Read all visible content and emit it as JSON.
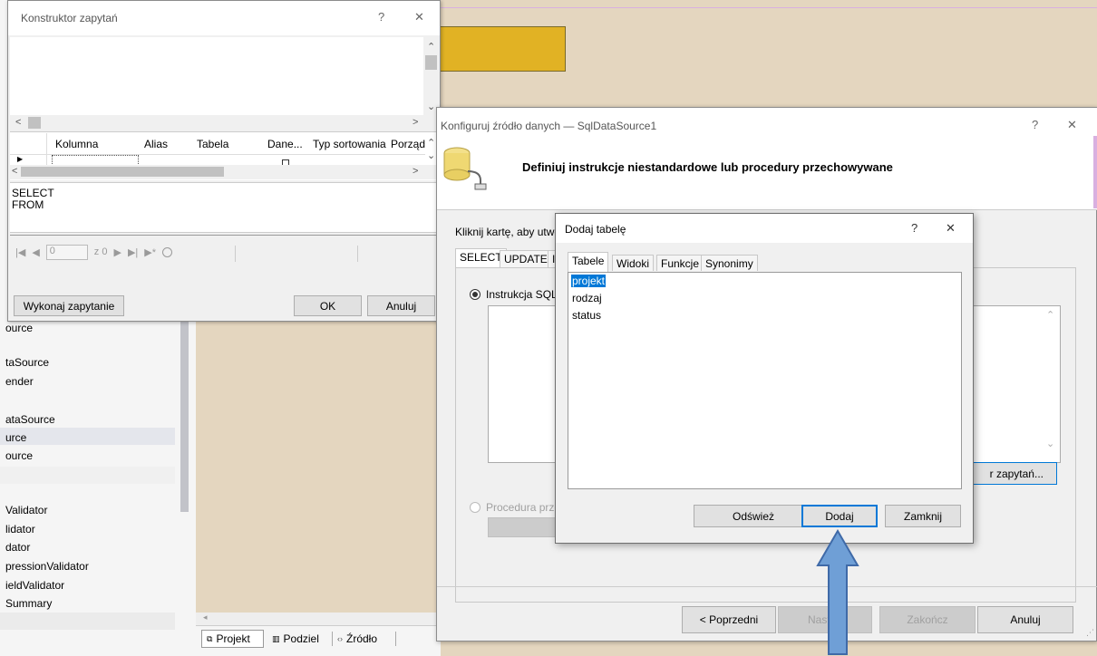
{
  "colors": {
    "designer_bg": "#e4d6bf",
    "yellow_box": "#e1b224",
    "dialog_bg": "#f0f0f0",
    "selection": "#0078d7",
    "arrow_fill": "#6f9fd6",
    "arrow_stroke": "#3f6aa8"
  },
  "toolbox": {
    "items": [
      "ource",
      "taSource",
      "ender",
      "ataSource",
      "urce",
      "ource",
      "Validator",
      "lidator",
      "dator",
      "pressionValidator",
      "ieldValidator",
      "Summary"
    ]
  },
  "design_bottom": {
    "tabs": [
      {
        "icon": "⧉",
        "label": "Projekt"
      },
      {
        "icon": "▥",
        "label": "Podziel"
      },
      {
        "icon": "‹›",
        "label": "Źródło"
      }
    ]
  },
  "query_builder": {
    "title": "Konstruktor zapytań",
    "help": "?",
    "close": "✕",
    "columns": [
      "Kolumna",
      "Alias",
      "Tabela",
      "Dane...",
      "Typ sortowania",
      "Porząd"
    ],
    "sql_lines": [
      "SELECT",
      "FROM"
    ],
    "nav": {
      "page_value": "0",
      "of_label": "z 0"
    },
    "execute_label": "Wykonaj zapytanie",
    "ok_label": "OK",
    "cancel_label": "Anuluj"
  },
  "configure": {
    "title": "Konfiguruj źródło danych — SqlDataSource1",
    "help": "?",
    "close": "✕",
    "heading": "Definiuj instrukcje niestandardowe lub procedury przechowywane",
    "instruction": "Kliknij kartę, aby utwo",
    "tabs": [
      "SELECT",
      "UPDATE",
      "I"
    ],
    "sql_radio_label": "Instrukcja SQL:",
    "proc_radio_label": "Procedura prze",
    "query_builder_btn": "r zapytań...",
    "prev_label": "< Poprzedni",
    "next_label": "Następ",
    "finish_label": "Zakończ",
    "cancel_label": "Anuluj"
  },
  "add_table": {
    "title": "Dodaj tabelę",
    "help": "?",
    "close": "✕",
    "tabs": [
      "Tabele",
      "Widoki",
      "Funkcje",
      "Synonimy"
    ],
    "items": [
      "projekt",
      "rodzaj",
      "status"
    ],
    "selected_index": 0,
    "refresh_label": "Odśwież",
    "add_label": "Dodaj",
    "close_label": "Zamknij"
  }
}
